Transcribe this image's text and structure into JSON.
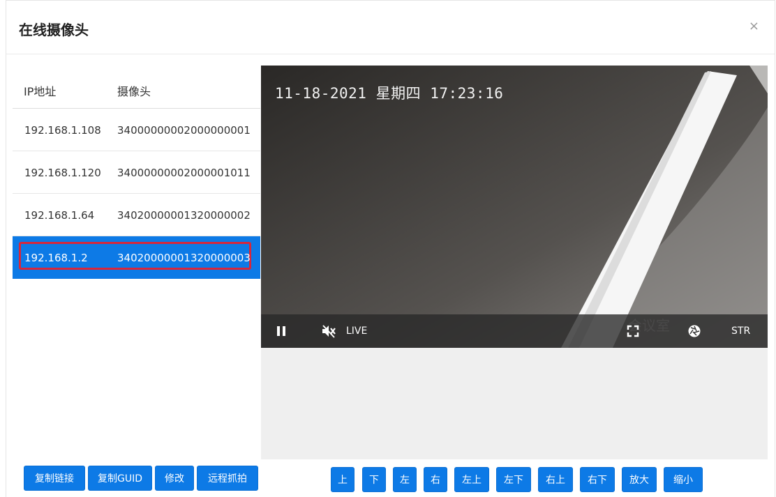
{
  "dialog": {
    "title": "在线摄像头",
    "close_label": "×"
  },
  "list": {
    "headers": {
      "ip": "IP地址",
      "camera": "摄像头"
    },
    "rows": [
      {
        "ip": "192.168.1.108",
        "camera": "34000000002000000001"
      },
      {
        "ip": "192.168.1.120",
        "camera": "34000000002000001011"
      },
      {
        "ip": "192.168.1.64",
        "camera": "34020000001320000002"
      },
      {
        "ip": "192.168.1.2",
        "camera": "34020000001320000003",
        "selected": true
      }
    ]
  },
  "video": {
    "osd_text": "11-18-2021 星期四 17:23:16",
    "room_text": "会议室",
    "controls": {
      "pause_icon": "pause-icon",
      "mute_icon": "volume-mute-icon",
      "live_label": "LIVE",
      "fullscreen_icon": "fullscreen-icon",
      "snapshot_icon": "shutter-icon",
      "str_label": "STR"
    }
  },
  "actions": {
    "copy_link": "复制链接",
    "copy_guid": "复制GUID",
    "edit": "修改",
    "remote_capture": "远程抓拍"
  },
  "ptz": {
    "up": "上",
    "down": "下",
    "left": "左",
    "right": "右",
    "up_left": "左上",
    "down_left": "左下",
    "up_right": "右上",
    "down_right": "右下",
    "zoom_in": "放大",
    "zoom_out": "缩小"
  },
  "colors": {
    "accent": "#0d7ae6",
    "selection_outline": "#d9263a"
  }
}
